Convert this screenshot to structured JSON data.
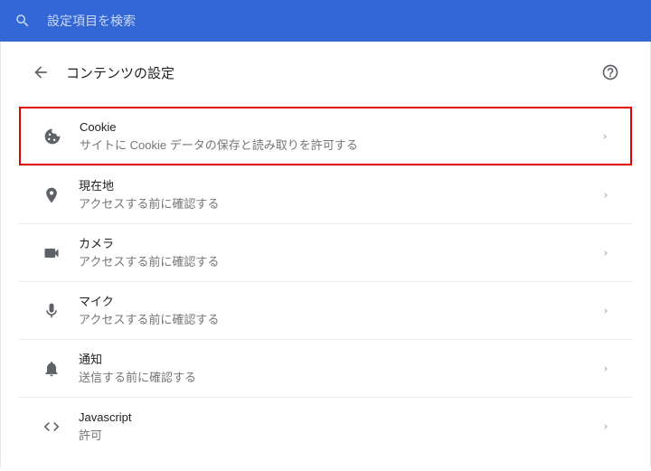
{
  "search": {
    "placeholder": "設定項目を検索"
  },
  "header": {
    "title": "コンテンツの設定"
  },
  "items": [
    {
      "title": "Cookie",
      "subtitle": "サイトに Cookie データの保存と読み取りを許可する",
      "highlight": true
    },
    {
      "title": "現在地",
      "subtitle": "アクセスする前に確認する",
      "highlight": false
    },
    {
      "title": "カメラ",
      "subtitle": "アクセスする前に確認する",
      "highlight": false
    },
    {
      "title": "マイク",
      "subtitle": "アクセスする前に確認する",
      "highlight": false
    },
    {
      "title": "通知",
      "subtitle": "送信する前に確認する",
      "highlight": false
    },
    {
      "title": "Javascript",
      "subtitle": "許可",
      "highlight": false
    }
  ]
}
